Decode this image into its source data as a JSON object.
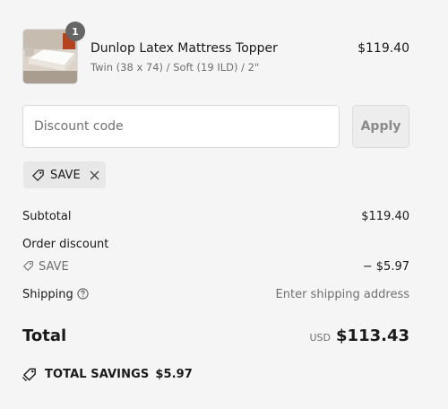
{
  "cart": {
    "item": {
      "quantity": "1",
      "title": "Dunlop Latex Mattress Topper",
      "variant": "Twin (38 x 74) / Soft (19 ILD) / 2\"",
      "price": "$119.40",
      "image_icon": "mattress-topper-photo"
    }
  },
  "discount": {
    "placeholder": "Discount code",
    "value": "",
    "apply_label": "Apply",
    "applied_code": "SAVE",
    "tag_icon": "tag-icon",
    "remove_icon": "close-icon"
  },
  "summary": {
    "subtotal_label": "Subtotal",
    "subtotal_value": "$119.40",
    "order_discount_label": "Order discount",
    "discount_code": "SAVE",
    "discount_value": "− $5.97",
    "shipping_label": "Shipping",
    "shipping_value": "Enter shipping address",
    "help_icon": "question-circle-icon"
  },
  "total": {
    "label": "Total",
    "currency": "USD",
    "amount": "$113.43"
  },
  "savings": {
    "label": "TOTAL SAVINGS",
    "amount": "$5.97",
    "icon": "tags-icon"
  },
  "colors": {
    "background": "#f5f5f5",
    "badge": "#666666",
    "muted_text": "#707070"
  }
}
